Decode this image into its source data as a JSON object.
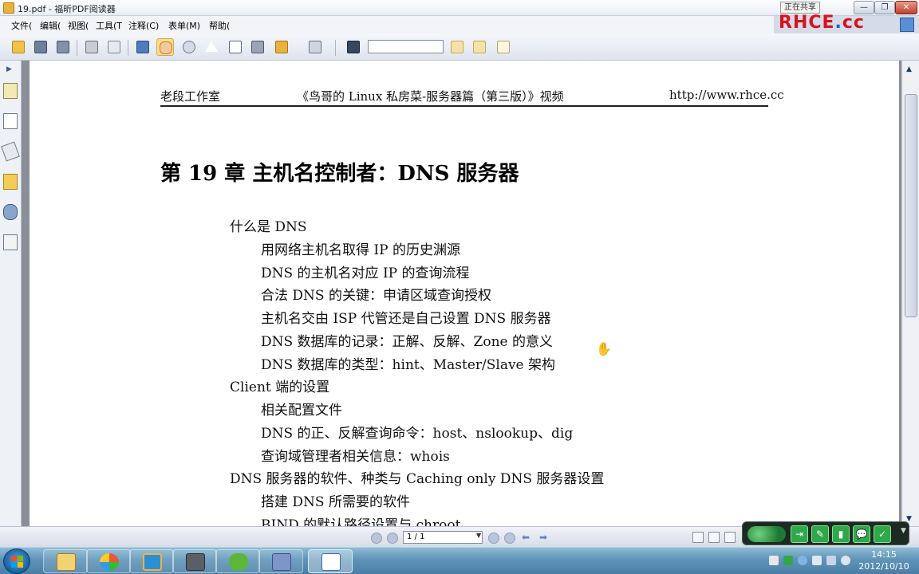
{
  "window": {
    "title": "19.pdf - 福昕PDF阅读器",
    "share_badge": "正在共享",
    "buttons": {
      "minimize": "—",
      "restore": "❐",
      "close": "✕"
    }
  },
  "brand": {
    "text_main": "RHCE",
    "text_dot": ".",
    "text_tail": "cc"
  },
  "menu": [
    "文件(",
    "编辑(",
    "视图(",
    "工具(T",
    "注释(C)",
    "表单(M)",
    "帮助("
  ],
  "toolbar": {
    "buttons": [
      "open-folder",
      "save",
      "save-as",
      "print",
      "email",
      "screen",
      "hand-tool",
      "zoom-tool",
      "select-arrow",
      "text-select",
      "snapshot",
      "rms",
      "typewriter",
      "find-binoculars",
      "prev-find",
      "next-find",
      "doc-properties"
    ],
    "find_value": ""
  },
  "colors": {
    "accent": "#1e62b8",
    "brand_red": "#d7141b",
    "page_bg": "#ffffff",
    "doc_bg": "#8a8e96"
  },
  "page": {
    "header": {
      "left": "老段工作室",
      "center": "《鸟哥的 Linux 私房菜-服务器篇（第三版）》视频",
      "right": "http://www.rhce.cc"
    },
    "chapter_title": "第 19 章  主机名控制者：DNS 服务器",
    "toc": [
      {
        "level": 1,
        "text": "什么是 DNS"
      },
      {
        "level": 2,
        "text": "用网络主机名取得 IP 的历史渊源"
      },
      {
        "level": 2,
        "text": "DNS 的主机名对应 IP 的查询流程"
      },
      {
        "level": 2,
        "text": "合法 DNS 的关键：申请区域查询授权"
      },
      {
        "level": 2,
        "text": "主机名交由 ISP 代管还是自己设置 DNS 服务器"
      },
      {
        "level": 2,
        "text": "DNS 数据库的记录：正解、反解、Zone 的意义"
      },
      {
        "level": 2,
        "text": "DNS 数据库的类型：hint、Master/Slave 架构"
      },
      {
        "level": 1,
        "text": "Client 端的设置"
      },
      {
        "level": 2,
        "text": "相关配置文件"
      },
      {
        "level": 2,
        "text": "DNS 的正、反解查询命令：host、nslookup、dig"
      },
      {
        "level": 2,
        "text": "查询域管理者相关信息：whois"
      },
      {
        "level": 1,
        "text": "DNS  服务器的软件、种类与 Caching only DNS 服务器设置"
      },
      {
        "level": 2,
        "text": "搭建 DNS 所需要的软件"
      },
      {
        "level": 2,
        "text": "BIND 的默认路径设置与  chroot"
      }
    ]
  },
  "status": {
    "page_indicator": "1 / 1"
  },
  "share_panel": {
    "buttons": [
      "⇥",
      "✎",
      "▮",
      "💬",
      "✓"
    ],
    "more": "▼"
  },
  "taskbar": {
    "apps": [
      "explorer",
      "media-center",
      "browser",
      "media-player",
      "parrot-app",
      "network-app",
      "pdf-reader"
    ],
    "clock_time": "14:15",
    "clock_date": "2012/10/10"
  }
}
